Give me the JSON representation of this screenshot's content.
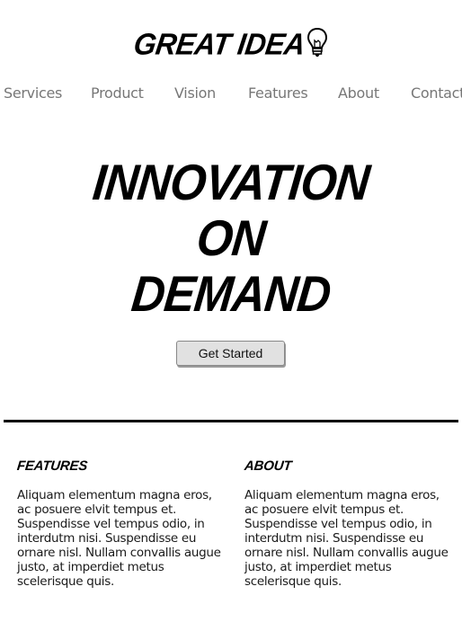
{
  "header": {
    "logo_text": "GREAT IDEA",
    "logo_icon": "lightbulb-icon"
  },
  "nav": {
    "items": [
      {
        "label": "Services"
      },
      {
        "label": "Product"
      },
      {
        "label": "Vision"
      },
      {
        "label": "Features"
      },
      {
        "label": "About"
      },
      {
        "label": "Contact"
      }
    ]
  },
  "hero": {
    "lines": [
      "INNOVATION",
      "ON",
      "DEMAND"
    ],
    "cta_label": "Get Started"
  },
  "sections": [
    {
      "heading": "FEATURES",
      "body": "Aliquam elementum magna eros, ac posuere elvit tempus et. Suspendisse vel tempus odio, in interdutm nisi. Suspendisse eu ornare nisl. Nullam convallis augue justo, at imperdiet metus scelerisque quis."
    },
    {
      "heading": "ABOUT",
      "body": "Aliquam elementum magna eros, ac posuere elvit tempus et. Suspendisse vel tempus odio, in interdutm nisi. Suspendisse eu ornare nisl. Nullam convallis augue justo, at imperdiet metus scelerisque quis."
    }
  ],
  "colors": {
    "nav_text": "#777777",
    "button_bg": "#e1e1e1",
    "divider": "#000000"
  }
}
